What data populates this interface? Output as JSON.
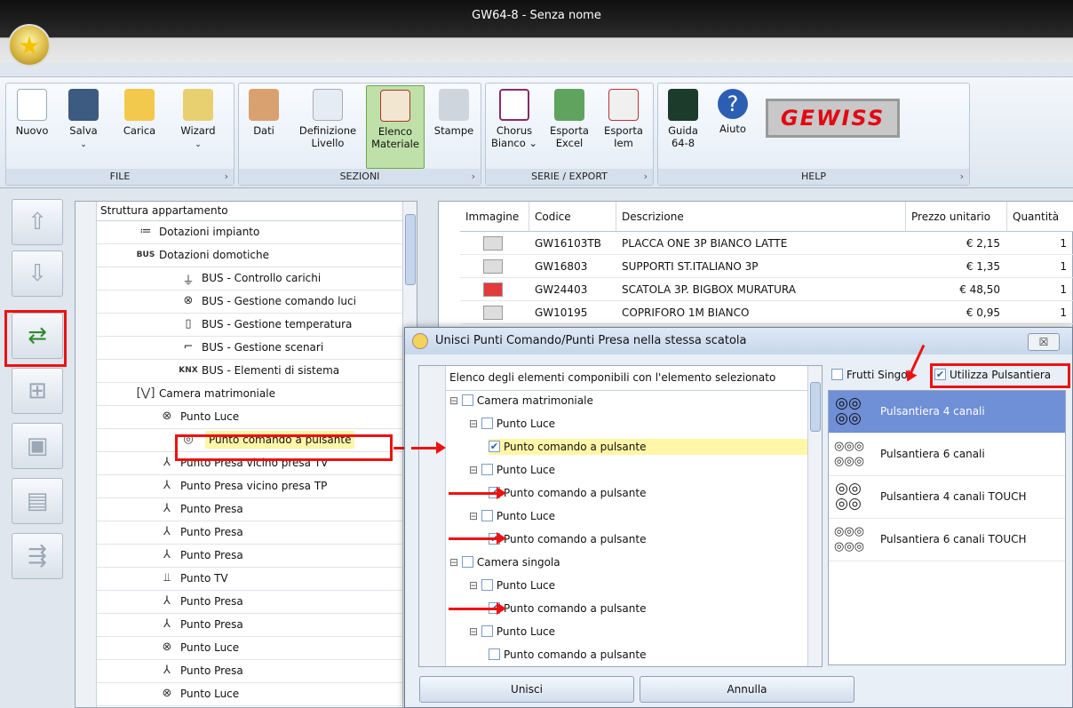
{
  "window": {
    "title": "GW64-8 - Senza nome"
  },
  "ribbon": {
    "groups": {
      "file": "FILE",
      "sezioni": "SEZIONI",
      "serie": "SERIE / EXPORT",
      "help": "HELP"
    },
    "buttons": {
      "nuovo": "Nuovo",
      "salva": "Salva",
      "carica": "Carica",
      "wizard": "Wizard",
      "dati": "Dati",
      "definizione": "Definizione",
      "livello": "Livello",
      "elenco": "Elenco",
      "materiale": "Materiale",
      "stampe": "Stampe",
      "chorus": "Chorus",
      "bianco": "Bianco",
      "esporta1": "Esporta",
      "excel": "Excel",
      "esporta2": "Esporta",
      "iem": "Iem",
      "guida": "Guida",
      "guida2": "64-8",
      "aiuto": "Aiuto"
    },
    "logo": "GEWISS"
  },
  "tree": {
    "header": "Struttura appartamento",
    "rows": [
      {
        "label": "Dotazioni impianto",
        "icon": "≔"
      },
      {
        "label": "Dotazioni domotiche",
        "icon": "BUS"
      },
      {
        "label": "BUS - Controllo carichi",
        "icon": "⏚"
      },
      {
        "label": "BUS - Gestione comando luci",
        "icon": "⊗"
      },
      {
        "label": "BUS - Gestione temperatura",
        "icon": "▯"
      },
      {
        "label": "BUS - Gestione scenari",
        "icon": "⌐"
      },
      {
        "label": "BUS - Elementi di sistema",
        "icon": "KNX"
      },
      {
        "label": "Camera matrimoniale",
        "icon": "[⋁]"
      },
      {
        "label": "Punto Luce",
        "icon": "⊗"
      },
      {
        "label": "Punto comando a pulsante",
        "icon": "◎"
      },
      {
        "label": "Punto Presa vicino presa TV",
        "icon": "⅄"
      },
      {
        "label": "Punto Presa vicino presa TP",
        "icon": "⅄"
      },
      {
        "label": "Punto Presa",
        "icon": "⅄"
      },
      {
        "label": "Punto Presa",
        "icon": "⅄"
      },
      {
        "label": "Punto Presa",
        "icon": "⅄"
      },
      {
        "label": "Punto TV",
        "icon": "⫫"
      },
      {
        "label": "Punto Presa",
        "icon": "⅄"
      },
      {
        "label": "Punto Presa",
        "icon": "⅄"
      },
      {
        "label": "Punto Luce",
        "icon": "⊗"
      },
      {
        "label": "Punto Presa",
        "icon": "⅄"
      },
      {
        "label": "Punto Luce",
        "icon": "⊗"
      }
    ]
  },
  "grid": {
    "headers": [
      "Immagine",
      "Codice",
      "Descrizione",
      "Prezzo unitario",
      "Quantità"
    ],
    "rows": [
      {
        "codice": "GW16103TB",
        "descrizione": "PLACCA ONE 3P BIANCO LATTE",
        "prezzo": "€ 2,15",
        "qta": "1"
      },
      {
        "codice": "GW16803",
        "descrizione": "SUPPORTI ST.ITALIANO 3P",
        "prezzo": "€ 1,35",
        "qta": "1"
      },
      {
        "codice": "GW24403",
        "descrizione": "SCATOLA 3P. BIGBOX MURATURA",
        "prezzo": "€ 48,50",
        "qta": "1"
      },
      {
        "codice": "GW10195",
        "descrizione": "COPRIFORO 1M BIANCO",
        "prezzo": "€ 0,95",
        "qta": "1"
      }
    ]
  },
  "dialog": {
    "title": "Unisci Punti Comando/Punti Presa nella stessa scatola",
    "close": "☒",
    "tree_header": "Elenco degli elementi componibili con l'elemento selezionato",
    "rows": [
      {
        "label": "Camera matrimoniale",
        "checked": false
      },
      {
        "label": "Punto Luce",
        "checked": false
      },
      {
        "label": "Punto comando a pulsante",
        "checked": true
      },
      {
        "label": "Punto Luce",
        "checked": false
      },
      {
        "label": "Punto comando a pulsante",
        "checked": true
      },
      {
        "label": "Punto Luce",
        "checked": false
      },
      {
        "label": "Punto comando a pulsante",
        "checked": true
      },
      {
        "label": "Camera singola",
        "checked": false
      },
      {
        "label": "Punto Luce",
        "checked": false
      },
      {
        "label": "Punto comando a pulsante",
        "checked": true
      },
      {
        "label": "Punto Luce",
        "checked": false
      },
      {
        "label": "Punto comando a pulsante",
        "checked": false
      }
    ],
    "frutti": "Frutti Singoli",
    "pulsantiera": "Utilizza Pulsantiera",
    "options": [
      "Pulsantiera 4 canali",
      "Pulsantiera 6 canali",
      "Pulsantiera 4 canali TOUCH",
      "Pulsantiera 6 canali TOUCH"
    ],
    "unisci": "Unisci",
    "annulla": "Annulla"
  },
  "colors": {
    "highlight": "#6f8fd6",
    "selected_row": "#fff6a8",
    "annotation": "#ee1111"
  }
}
